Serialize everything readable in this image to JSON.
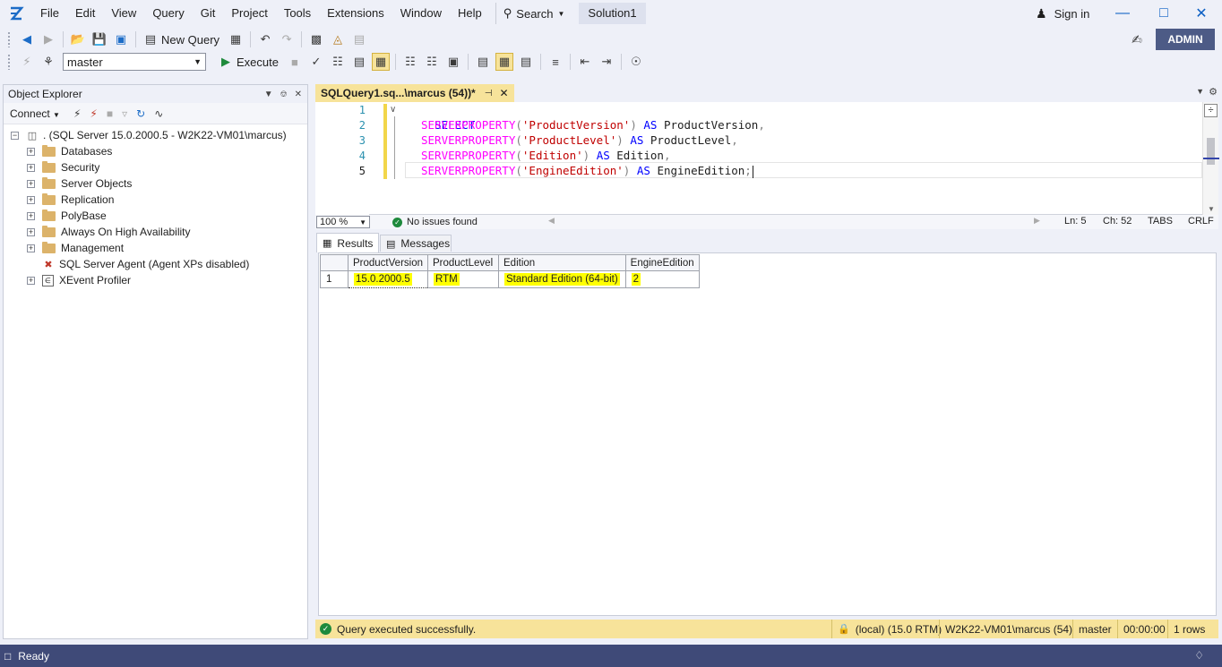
{
  "menu": {
    "items": [
      "File",
      "Edit",
      "View",
      "Query",
      "Git",
      "Project",
      "Tools",
      "Extensions",
      "Window",
      "Help"
    ],
    "search_label": "Search",
    "solution": "Solution1",
    "sign_in": "Sign in",
    "admin_badge": "ADMIN"
  },
  "toolbar": {
    "new_query": "New Query",
    "database": "master",
    "execute": "Execute"
  },
  "object_explorer": {
    "title": "Object Explorer",
    "connect": "Connect",
    "server_node": ". (SQL Server 15.0.2000.5 - W2K22-VM01\\marcus)",
    "folders": [
      "Databases",
      "Security",
      "Server Objects",
      "Replication",
      "PolyBase",
      "Always On High Availability",
      "Management"
    ],
    "agent": "SQL Server Agent (Agent XPs disabled)",
    "xevent": "XEvent Profiler"
  },
  "editor": {
    "tab_title": "SQLQuery1.sq...\\marcus (54))*",
    "line_numbers": [
      "1",
      "2",
      "3",
      "4",
      "5"
    ],
    "code": {
      "select": "SELECT",
      "fn": "SERVERPROPERTY",
      "as": "AS",
      "lines": [
        {
          "arg": "'ProductVersion'",
          "alias": "ProductVersion",
          "end": ","
        },
        {
          "arg": "'ProductLevel'",
          "alias": "ProductLevel",
          "end": ","
        },
        {
          "arg": "'Edition'",
          "alias": "Edition",
          "end": ","
        },
        {
          "arg": "'EngineEdition'",
          "alias": "EngineEdition",
          "end": ";"
        }
      ]
    },
    "zoom": "100 %",
    "issues": "No issues found",
    "ln": "Ln: 5",
    "ch": "Ch: 52",
    "tabs": "TABS",
    "crlf": "CRLF"
  },
  "results": {
    "tab_results": "Results",
    "tab_messages": "Messages",
    "columns": [
      "ProductVersion",
      "ProductLevel",
      "Edition",
      "EngineEdition"
    ],
    "rows": [
      {
        "num": "1",
        "cells": [
          "15.0.2000.5",
          "RTM",
          "Standard Edition (64-bit)",
          "2"
        ]
      }
    ]
  },
  "query_status": {
    "message": "Query executed successfully.",
    "server": "(local) (15.0 RTM)",
    "user": "W2K22-VM01\\marcus (54)",
    "database": "master",
    "elapsed": "00:00:00",
    "rows": "1 rows"
  },
  "app_status": {
    "text": "Ready"
  },
  "colors": {
    "accent_yellow": "#f7e39a",
    "status_bar": "#3f4a78",
    "admin_badge": "#4d5b86"
  }
}
